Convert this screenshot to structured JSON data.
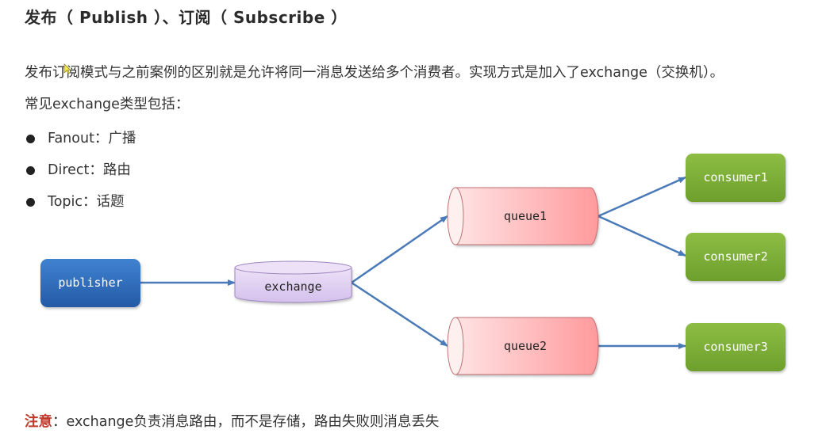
{
  "title": "发布（ Publish ）、订阅（ Subscribe ）",
  "paragraphs": [
    "发布订阅模式与之前案例的区别就是允许将同一消息发送给多个消费者。实现方式是加入了exchange（交换机）。",
    "常见exchange类型包括："
  ],
  "exchange_types": [
    {
      "label": "Fanout：广播"
    },
    {
      "label": "Direct：路由"
    },
    {
      "label": "Topic：话题"
    }
  ],
  "note": {
    "prefix": "注意",
    "text": "：exchange负责消息路由，而不是存储，路由失败则消息丢失"
  },
  "diagram": {
    "nodes": {
      "publisher": {
        "label": "publisher",
        "shape": "rounded-rect",
        "color": "#2e6dbd"
      },
      "exchange": {
        "label": "exchange",
        "shape": "cylinder",
        "color": "#d9c8ee"
      },
      "queue1": {
        "label": "queue1",
        "shape": "horizontal-cylinder",
        "color": "#ff9fa0"
      },
      "queue2": {
        "label": "queue2",
        "shape": "horizontal-cylinder",
        "color": "#ff9fa0"
      },
      "consumer1": {
        "label": "consumer1",
        "shape": "rounded-rect",
        "color": "#7aab35"
      },
      "consumer2": {
        "label": "consumer2",
        "shape": "rounded-rect",
        "color": "#7aab35"
      },
      "consumer3": {
        "label": "consumer3",
        "shape": "rounded-rect",
        "color": "#7aab35"
      }
    },
    "edges": [
      {
        "from": "publisher",
        "to": "exchange"
      },
      {
        "from": "exchange",
        "to": "queue1"
      },
      {
        "from": "exchange",
        "to": "queue2"
      },
      {
        "from": "queue1",
        "to": "consumer1"
      },
      {
        "from": "queue1",
        "to": "consumer2"
      },
      {
        "from": "queue2",
        "to": "consumer3"
      }
    ],
    "edge_color": "#4a7ab8"
  }
}
